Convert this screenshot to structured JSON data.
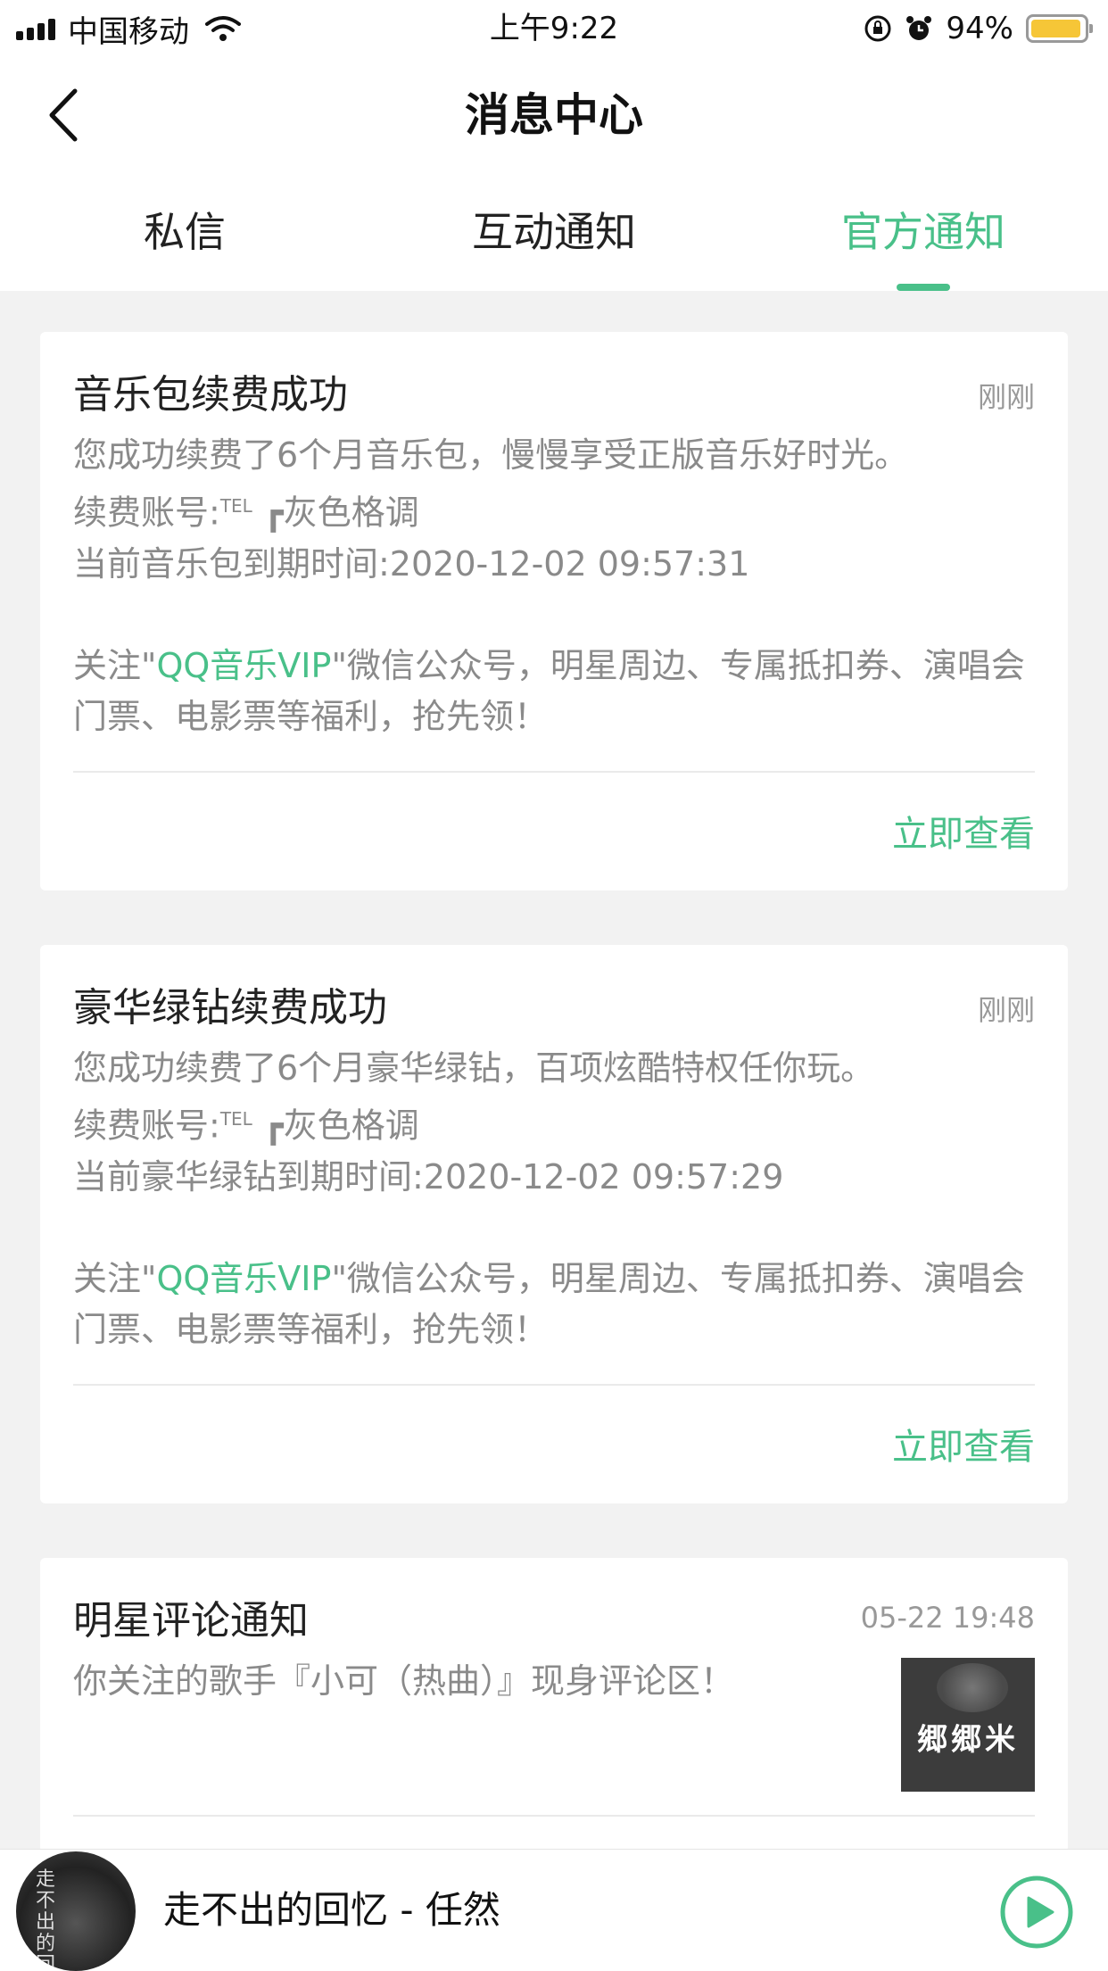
{
  "status_bar": {
    "carrier": "中国移动",
    "time": "上午9:22",
    "battery": "94%",
    "battery_level": 0.94
  },
  "nav": {
    "title": "消息中心"
  },
  "tabs": [
    {
      "label": "私信",
      "active": false
    },
    {
      "label": "互动通知",
      "active": false
    },
    {
      "label": "官方通知",
      "active": true
    }
  ],
  "cards": [
    {
      "title": "音乐包续费成功",
      "time": "刚刚",
      "line1": "您成功续费了6个月音乐包，慢慢享受正版音乐好时光。",
      "account_label": "续费账号:",
      "account_tel": "TEL",
      "account_name": "灰色格调",
      "expiry": "当前音乐包到期时间:2020-12-02 09:57:31",
      "promo_pre": "关注\"",
      "promo_link": "QQ音乐VIP",
      "promo_post": "\"微信公众号，明星周边、专属抵扣券、演唱会门票、电影票等福利，抢先领！",
      "action": "立即查看"
    },
    {
      "title": "豪华绿钻续费成功",
      "time": "刚刚",
      "line1": "您成功续费了6个月豪华绿钻，百项炫酷特权任你玩。",
      "account_label": "续费账号:",
      "account_tel": "TEL",
      "account_name": "灰色格调",
      "expiry": "当前豪华绿钻到期时间:2020-12-02 09:57:29",
      "promo_pre": "关注\"",
      "promo_link": "QQ音乐VIP",
      "promo_post": "\"微信公众号，明星周边、专属抵扣券、演唱会门票、电影票等福利，抢先领！",
      "action": "立即查看"
    },
    {
      "title": "明星评论通知",
      "time": "05-22 19:48",
      "line1": "你关注的歌手『小可（热曲）』现身评论区！",
      "thumb_text": "郷郷米"
    }
  ],
  "player": {
    "song": "走不出的回忆 - 任然",
    "cover_text": "走不出的回忆"
  },
  "colors": {
    "accent": "#49c089",
    "battery": "#f6c637"
  }
}
